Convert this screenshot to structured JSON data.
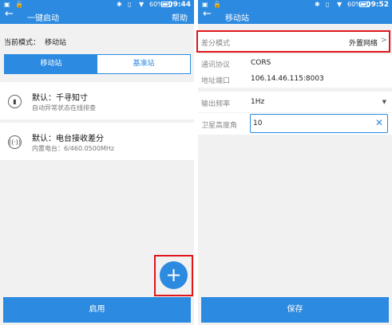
{
  "left": {
    "status": {
      "battery": "60%",
      "time": "09:44"
    },
    "title": "一键启动",
    "help": "帮助",
    "mode_label": "当前模式：",
    "mode_value": "移动站",
    "tabs": [
      {
        "label": "移动站"
      },
      {
        "label": "基准站"
      }
    ],
    "cards": [
      {
        "title": "默认：千寻知寸",
        "subtitle": "自动异常状态在线排查"
      },
      {
        "title": "默认：电台接收差分",
        "subtitle": "内置电台：6/460.0500MHz"
      }
    ],
    "start_button": "启用"
  },
  "right": {
    "status": {
      "battery": "60%",
      "time": "09:52"
    },
    "title": "移动站",
    "diff_label": "差分模式",
    "diff_value": "外置网络",
    "rows": [
      {
        "label": "通讯协议",
        "value": "CORS"
      },
      {
        "label": "地址端口",
        "value": "106.14.46.115:8003"
      },
      {
        "label": "输出频率",
        "value": "1Hz"
      }
    ],
    "cutoff_label": "卫星高度角",
    "cutoff_value": "10",
    "save_button": "保存"
  },
  "colors": {
    "primary": "#2c8ae0",
    "highlight": "#e0161b"
  }
}
